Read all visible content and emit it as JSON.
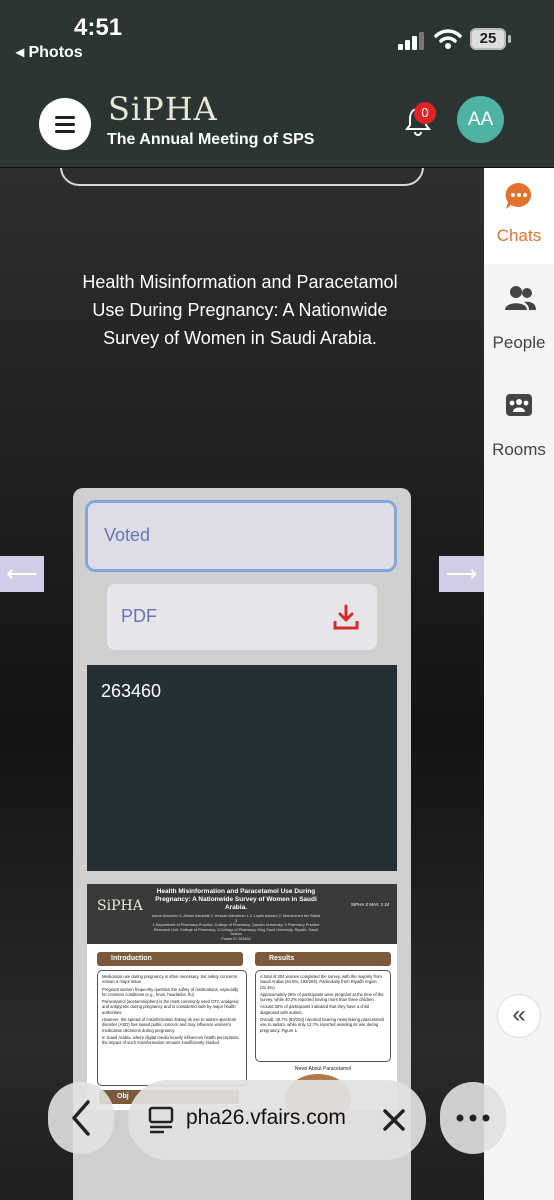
{
  "status_bar": {
    "time": "4:51",
    "back_label": "◂ Photos",
    "battery": "25"
  },
  "header": {
    "logo_text": "SiPHA",
    "subtitle": "The Annual Meeting of SPS",
    "notification_count": "0",
    "avatar_initials": "AA"
  },
  "poster_title": "Health Misinformation and Paracetamol Use During Pregnancy: A Nationwide Survey of Women in Saudi Arabia.",
  "card": {
    "voted_label": "Voted",
    "pdf_label": "PDF",
    "poster_id": "263460"
  },
  "poster_preview": {
    "logo": "SiPHA",
    "title": "Health Misinformation and Paracetamol Use During Pregnancy: A Nationwide Survey of Women in Saudi Arabia.",
    "authors": "Asma Almumen 2, Amani Alsubaiti 2, Hessah Alsharhan 1,2, Lujain Alazam 2, Mohammed bin Rabat 3",
    "affiliations": "1 Department of Pharmacy Practice, College of Pharmacy, Qassim University; 2 Pharmacy Practice Research Unit, College of Pharmacy; 3 College of Pharmacy, King Saud University, Riyadh, Saudi Arabia",
    "poster_id_line": "Poster ID 263460",
    "date": "SIPHA 2 MAY, 2 24",
    "intro_heading": "Introduction",
    "results_heading": "Results",
    "intro_points": [
      "Medication use during pregnancy is often necessary, but safety concerns remain a major issue.",
      "Pregnant women frequently question the safety of medications, especially for common conditions (e.g., fever, headache, flu).",
      "Paracetamol (acetaminophen) is the most commonly used OTC analgesic and antipyretic during pregnancy and is considered safe by major health authorities.",
      "However, the spread of misinformation linking its use to autism spectrum disorder (ASD) has raised public concern and may influence women's medication decisions during pregnancy.",
      "In Saudi Arabia, where digital media heavily influences health perceptions, the impact of such misinformation remains insufficiently studied."
    ],
    "results_points": [
      "A total of 204 women completed the survey, with the majority from Saudi Arabia (94.6%, 193/204). Particularly from Riyadh region (31.4%).",
      "Approximately 26% of participants were pregnant at the time of the survey, while 40.2% reported having more than three children.",
      "Around 35% of participants indicated that they have a child diagnosed with autism.",
      "Overall, 40.7% (83/204) reported hearing news linking paracetamol use to autism, while only 12.7% reported avoiding its use during pregnancy. Figure 1."
    ],
    "news_label": "News About Paracetamol",
    "objectives_partial": "Obj"
  },
  "sidebar": [
    {
      "label": "Chats",
      "icon": "chat-bubble-icon"
    },
    {
      "label": "People",
      "icon": "people-icon"
    },
    {
      "label": "Rooms",
      "icon": "rooms-icon"
    }
  ],
  "collapse_label": "«",
  "browser": {
    "url": "pha26.vfairs.com"
  },
  "colors": {
    "accent": "#e2732e",
    "header_bg": "#2b3634",
    "avatar": "#4fb3a3",
    "voted_border": "#7fa9d9"
  }
}
